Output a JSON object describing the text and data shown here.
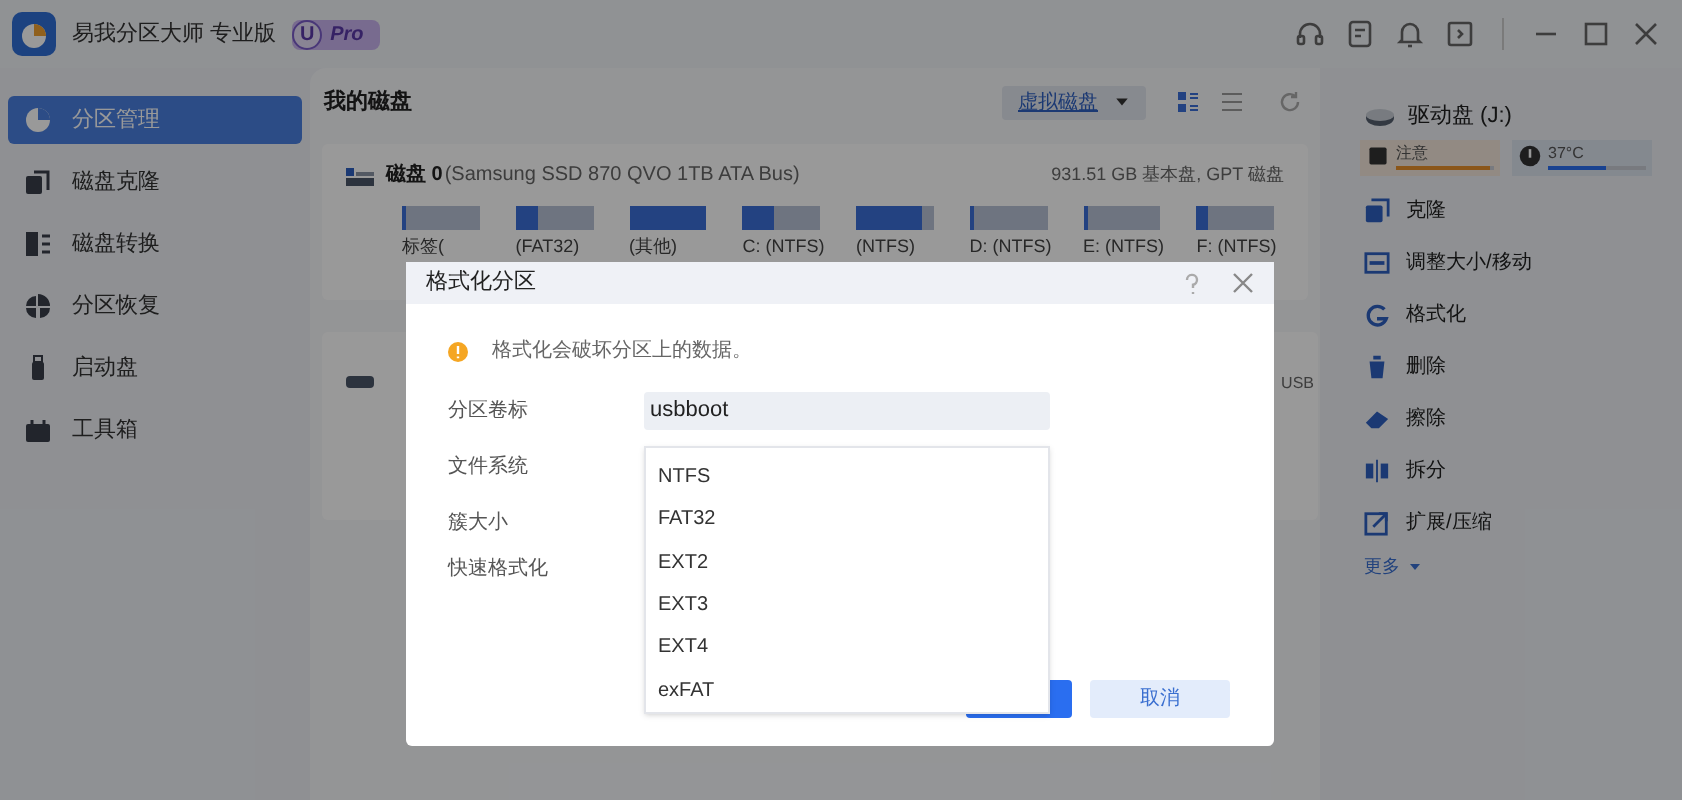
{
  "window": {
    "title": "易我分区大师 专业版",
    "badge_letter": "U",
    "badge": "Pro"
  },
  "sidebar": {
    "items": [
      {
        "label": "分区管理",
        "selected": true
      },
      {
        "label": "磁盘克隆",
        "selected": false
      },
      {
        "label": "磁盘转换",
        "selected": false
      },
      {
        "label": "分区恢复",
        "selected": false
      },
      {
        "label": "启动盘",
        "selected": false
      },
      {
        "label": "工具箱",
        "selected": false
      }
    ]
  },
  "main": {
    "heading": "我的磁盘",
    "virtual_disk_button": "虚拟磁盘",
    "disks": [
      {
        "kind": "full",
        "name": "磁盘 0",
        "model": "(Samsung SSD 870 QVO 1TB ATA Bus)",
        "info": "931.51 GB 基本盘, GPT 磁盘",
        "partitions": [
          {
            "label": "标签(",
            "level": 0.05
          },
          {
            "label": "(FAT32)",
            "level": 0.3
          },
          {
            "label": "(其他)",
            "level": 1
          },
          {
            "label": "C: (NTFS)",
            "level": 0.4
          },
          {
            "label": "(NTFS)",
            "level": 0.85
          },
          {
            "label": "D: (NTFS)",
            "level": 0.05
          },
          {
            "label": "E: (NTFS)",
            "level": 0.05
          },
          {
            "label": "F: (NTFS)",
            "level": 0.15
          }
        ]
      },
      {
        "kind": "covered",
        "info": "USB"
      }
    ]
  },
  "right_panel": {
    "drive": "驱动盘 (J:)",
    "health": {
      "label": "注意",
      "level": 0.95
    },
    "temperature": {
      "label": "37°C",
      "level": 0.6
    },
    "actions": [
      {
        "label": "克隆"
      },
      {
        "label": "调整大小/移动"
      },
      {
        "label": "格式化"
      },
      {
        "label": "删除"
      },
      {
        "label": "擦除"
      },
      {
        "label": "拆分"
      },
      {
        "label": "扩展/压缩"
      }
    ],
    "more": "更多"
  },
  "dialog": {
    "title": "格式化分区",
    "warning": "格式化会破坏分区上的数据。",
    "field_labels": [
      "分区卷标",
      "文件系统",
      "簇大小",
      "快速格式化"
    ],
    "volume_label": "usbboot",
    "filesystem_options": [
      "NTFS",
      "FAT32",
      "EXT2",
      "EXT3",
      "EXT4",
      "exFAT"
    ],
    "cancel_button": "取消"
  }
}
